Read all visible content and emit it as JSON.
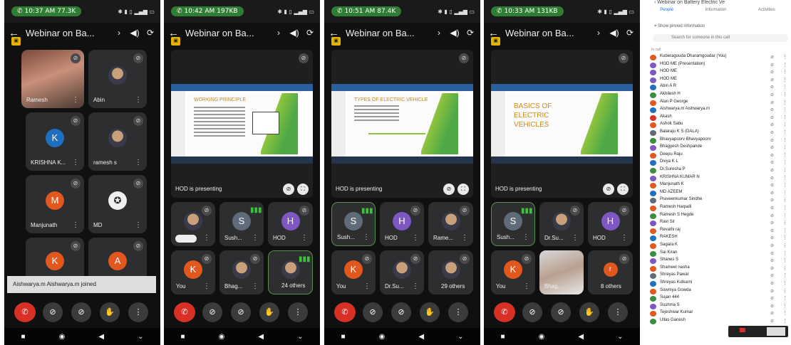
{
  "phones": [
    {
      "time": "10:37 AM",
      "speed": "77.3K",
      "title": "Webinar on Ba...",
      "tiles": [
        "Ramesh",
        "Abin",
        "KRISHNA K...",
        "ramesh s",
        "Manjunath",
        "MD",
        "",
        ""
      ],
      "avatar_letters": [
        "K",
        "M",
        "K",
        "A"
      ],
      "toast": "Aishwarya.m Aishwarya.m joined"
    },
    {
      "time": "10:42 AM",
      "speed": "197KB",
      "title": "Webinar on Ba...",
      "slide_title": "WORKING PRINCIPLE",
      "presenting": "HOD is presenting",
      "tiles": [
        "",
        "Sush...",
        "HOD",
        "You",
        "Bhag...",
        "24 others"
      ],
      "avatar_letters": [
        "S",
        "H",
        "K"
      ]
    },
    {
      "time": "10:51 AM",
      "speed": "87.4K",
      "title": "Webinar on Ba...",
      "slide_title": "TYPES OF ELECTRIC VEHICLE",
      "presenting": "HOD is presenting",
      "tiles": [
        "Sush...",
        "HOD",
        "Rame...",
        "You",
        "Dr.Su...",
        "29 others"
      ],
      "avatar_letters": [
        "S",
        "H",
        "K"
      ]
    },
    {
      "time": "10:33 AM",
      "speed": "131KB",
      "title": "Webinar on Ba...",
      "slide_title": "BASICS OF ELECTRIC VEHICLES",
      "presenting": "HOD is presenting",
      "tiles": [
        "Sush...",
        "Dr.Su...",
        "HOD",
        "You",
        "Bhag...",
        "8 others"
      ],
      "avatar_letters": [
        "S",
        "H",
        "K",
        "r"
      ]
    }
  ],
  "people": {
    "header": "Webinar on Battery Electric Ve",
    "tabs": [
      "People",
      "Information",
      "Activities"
    ],
    "pin": "Show pinned information",
    "search": "Search for someone in this call",
    "section": "In call",
    "list": [
      "Kuberagouda Dharamgoudar (You)",
      "HOD ME (Presentation)",
      "HOD ME",
      "HOD ME",
      "Abin A R",
      "Akhilesh H",
      "Alan P George",
      "Aishwarya.m Aishwarya.m",
      "Akash",
      "Ashok Sabu",
      "Balaraju K S (DALA)",
      "Bhavyapoorv Bhavyapoorv",
      "Bhagyesh Deshpande",
      "Deepu Raju",
      "Divya K L",
      "Dr.Suresha P",
      "KRISHNA KUMAR N",
      "Manjunath K",
      "MD AZEEM",
      "Praveenkumar Sindhe",
      "Ramesh Harpalli",
      "Ramesh S Hegde",
      "Ravi Sir",
      "Revathi raj",
      "RAKESH",
      "Sagara K",
      "Sai Kiran",
      "Shanes S",
      "Shameel nasha",
      "Shreyas Pawar",
      "Shreyas Kulkarni",
      "Sowmya Gowda",
      "Sujan 444",
      "Sushma S",
      "Tejeshwar Kumar",
      "Ullas Ganesh"
    ]
  },
  "colors": {
    "end_call": "#d93025",
    "pill": "#2f7d32",
    "speaking": "#3ec23e"
  }
}
